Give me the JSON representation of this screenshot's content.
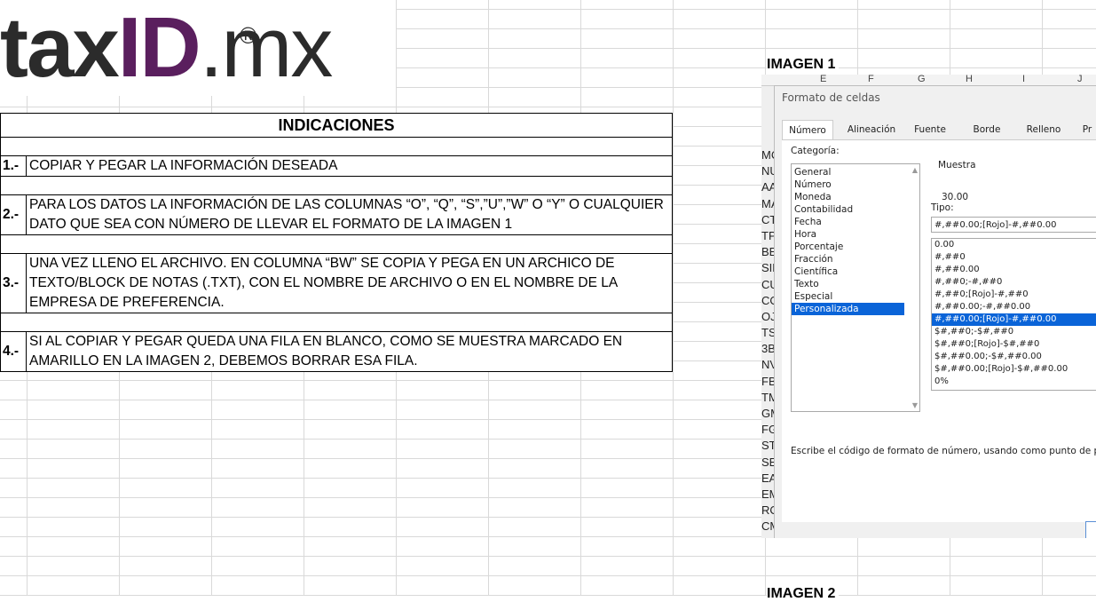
{
  "logo": {
    "tax": "tax",
    "id": "ID",
    "mx": ".mx",
    "reg": "®"
  },
  "instructions": {
    "heading": "INDICACIONES",
    "items": [
      {
        "num": "1.-",
        "text": "COPIAR Y PEGAR LA INFORMACIÓN DESEADA"
      },
      {
        "num": "2.-",
        "text": "PARA LOS DATOS LA INFORMACIÓN DE LAS COLUMNAS “O”, “Q”, “S”,”U”,”W”  O “Y” O CUALQUIER DATO QUE SEA CON NÚMERO DE LLEVAR EL FORMATO DE LA IMAGEN 1"
      },
      {
        "num": "3.-",
        "text": "UNA VEZ  LLENO EL ARCHIVO. EN COLUMNA “BW” SE COPIA Y PEGA EN UN ARCHICO DE TEXTO/BLOCK DE NOTAS (.TXT), CON EL NOMBRE DE ARCHIVO O EN EL NOMBRE DE LA EMPRESA DE PREFERENCIA."
      },
      {
        "num": "4.-",
        "text": "SI AL COPIAR Y PEGAR QUEDA UNA FILA EN BLANCO, COMO SE MUESTRA MARCADO EN AMARILLO EN LA IMAGEN 2, DEBEMOS BORRAR ESA FILA."
      }
    ]
  },
  "image1_label": "IMAGEN 1",
  "image2_label": "IMAGEN 2",
  "dialog": {
    "col_headers": [
      "E",
      "F",
      "G",
      "H",
      "I",
      "J"
    ],
    "left_cut": [
      "MC",
      "NU",
      "AA",
      "MA",
      "CT",
      "TP",
      "BE",
      "SIM",
      "CU",
      "CO",
      "OJ",
      "TS",
      "3B",
      "NV",
      "FB",
      "TM",
      "GM",
      "FG",
      "ST",
      "SE",
      "EA",
      "EM",
      "RO",
      "CM"
    ],
    "title": "Formato de celdas",
    "tabs": [
      "Número",
      "Alineación",
      "Fuente",
      "Borde",
      "Relleno",
      "Pr"
    ],
    "categoria_label": "Categoría:",
    "categories": [
      "General",
      "Número",
      "Moneda",
      "Contabilidad",
      "Fecha",
      "Hora",
      "Porcentaje",
      "Fracción",
      "Científica",
      "Texto",
      "Especial",
      "Personalizada"
    ],
    "selected_category": "Personalizada",
    "muestra_label": "Muestra",
    "muestra_value": "30.00",
    "tipo_label": "Tipo:",
    "tipo_value": "#,##0.00;[Rojo]-#,##0.00",
    "formats": [
      "0.00",
      "#,##0",
      "#,##0.00",
      "#,##0;-#,##0",
      "#,##0;[Rojo]-#,##0",
      "#,##0.00;-#,##0.00",
      "#,##0.00;[Rojo]-#,##0.00",
      "$#,##0;-$#,##0",
      "$#,##0;[Rojo]-$#,##0",
      "$#,##0.00;-$#,##0.00",
      "$#,##0.00;[Rojo]-$#,##0.00",
      "0%"
    ],
    "selected_format": "#,##0.00;[Rojo]-#,##0.00",
    "note": "Escribe el código de formato de número, usando como punto de partic"
  }
}
